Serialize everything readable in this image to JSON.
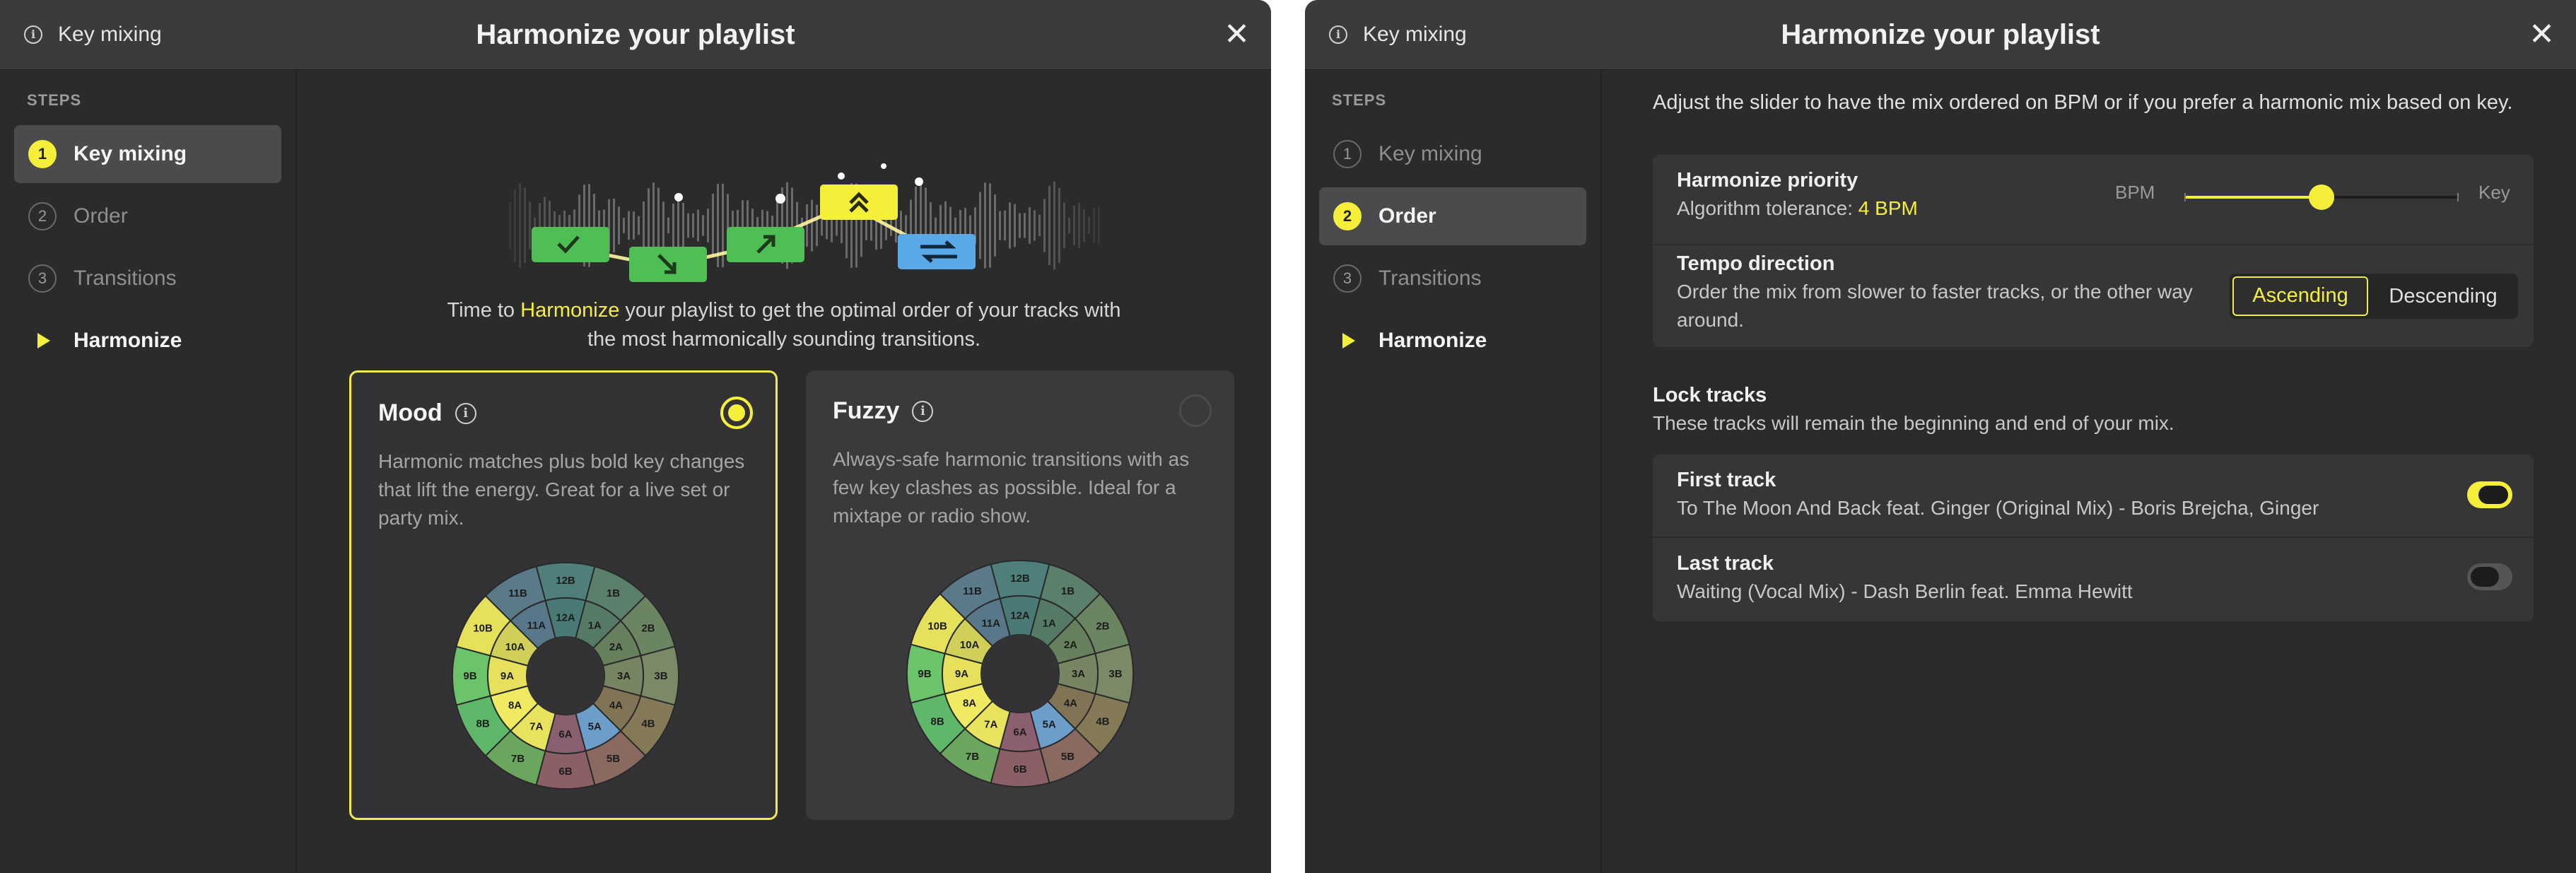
{
  "left": {
    "header": {
      "title": "Harmonize your playlist",
      "section": "Key mixing"
    },
    "sidebar": {
      "heading": "STEPS",
      "steps": [
        {
          "num": "1",
          "label": "Key mixing"
        },
        {
          "num": "2",
          "label": "Order"
        },
        {
          "num": "3",
          "label": "Transitions"
        },
        {
          "num": "",
          "label": "Harmonize"
        }
      ]
    },
    "intro": {
      "before": "Time to ",
      "highlight": "Harmonize",
      "after": " your playlist to get the optimal order of your tracks with",
      "line2": "the most harmonically sounding transitions."
    },
    "options": [
      {
        "title": "Mood",
        "desc": "Harmonic matches plus bold key changes that lift the energy. Great for a live set or party mix.",
        "selected": true
      },
      {
        "title": "Fuzzy",
        "desc": "Always-safe harmonic transitions with as few key clashes as possible. Ideal for a mixtape or radio show.",
        "selected": false
      }
    ]
  },
  "right": {
    "header": {
      "title": "Harmonize your playlist",
      "section": "Key mixing"
    },
    "sidebar": {
      "heading": "STEPS",
      "steps": [
        {
          "num": "1",
          "label": "Key mixing"
        },
        {
          "num": "2",
          "label": "Order"
        },
        {
          "num": "3",
          "label": "Transitions"
        },
        {
          "num": "",
          "label": "Harmonize"
        }
      ]
    },
    "intro": "Adjust the slider to have the mix ordered on BPM or if you prefer a harmonic mix based on key.",
    "priority": {
      "title": "Harmonize priority",
      "tolerance_label": "Algorithm tolerance: ",
      "tolerance_value": "4 BPM",
      "min_label": "BPM",
      "max_label": "Key",
      "value": 0.5
    },
    "tempo": {
      "title": "Tempo direction",
      "desc": "Order the mix from slower to faster tracks, or the other way around.",
      "options": [
        "Ascending",
        "Descending"
      ],
      "selected": "Ascending"
    },
    "lock": {
      "title": "Lock tracks",
      "desc": "These tracks will remain the beginning and end of your mix.",
      "first": {
        "label": "First track",
        "track": "To The Moon And Back feat. Ginger (Original Mix) - Boris Brejcha, Ginger",
        "on": true
      },
      "last": {
        "label": "Last track",
        "track": "Waiting (Vocal Mix) - Dash Berlin feat. Emma Hewitt",
        "on": false
      }
    }
  },
  "camelot": {
    "outer": [
      "12B",
      "1B",
      "2B",
      "3B",
      "4B",
      "5B",
      "6B",
      "7B",
      "8B",
      "9B",
      "10B",
      "11B"
    ],
    "inner": [
      "12A",
      "1A",
      "2A",
      "3A",
      "4A",
      "5A",
      "6A",
      "7A",
      "8A",
      "9A",
      "10A",
      "11A"
    ],
    "outer_colors": [
      "#4e7f7a",
      "#5a7f6a",
      "#6b8462",
      "#7a8a66",
      "#857a58",
      "#8a6a60",
      "#8a5f66",
      "#6aa65e",
      "#5fb86a",
      "#6cc46a",
      "#e6e15a",
      "#5a7a8a"
    ],
    "inner_colors": [
      "#4a7a76",
      "#557a66",
      "#66805e",
      "#788562",
      "#807454",
      "#6d9ec9",
      "#8a6070",
      "#e8e35e",
      "#f0ea62",
      "#e6e05c",
      "#cfcf5a",
      "#58788a"
    ]
  },
  "colors": {
    "accent": "#f5ef3a",
    "panel": "#363638",
    "background": "#2b2b2c"
  }
}
